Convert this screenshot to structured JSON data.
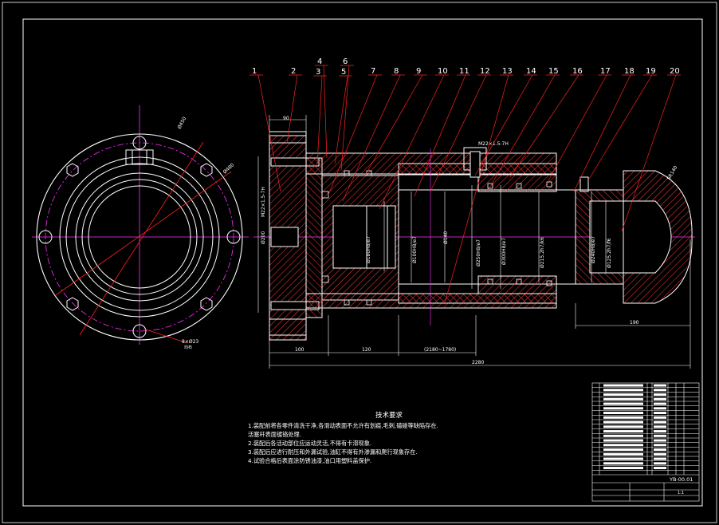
{
  "drawing": {
    "balloons": [
      "1",
      "2",
      "3",
      "4",
      "5",
      "6",
      "7",
      "8",
      "9",
      "10",
      "11",
      "12",
      "13",
      "14",
      "15",
      "16",
      "17",
      "18",
      "19",
      "20"
    ],
    "dims": {
      "bore_main": "Ø250H8/e7",
      "piston": "Ø180H8/e7",
      "rod": "Ø100H8/e7",
      "rod_b": "Ø140",
      "tube_ext": "Ø300H8/e7",
      "tube_ext2": "Ø325H8/e7",
      "gland": "Ø215.2h7/k6",
      "gland2": "Ø240H8/e7",
      "gland3": "Ø125.2h7/f6",
      "flange": "Ø200",
      "port": "M22×1.5-7H",
      "top_port": "M22×1.5-7H",
      "end_sph": "SR140",
      "len_100": "100",
      "len_120": "120",
      "len_stroke": "(2180~1780)",
      "len_total": "2280",
      "len_190": "190",
      "len_90": "90"
    },
    "flange_view": {
      "d1": "Ø450",
      "d2": "Ø480",
      "holes": "8×Ø23",
      "holes_note": "均布"
    }
  },
  "notes": {
    "title": "技术要求",
    "lines": [
      "1.装配前将各零件清洗干净,各滑动表面不允许有划痕,毛刺,磕碰等缺陷存在.",
      "  活塞杆表面镀铬处理.",
      "2.装配后各活动部位应运动灵活,不得有卡滞现象.",
      "3.装配后应进行耐压和外漏试验,油缸不得有外渗漏和爬行现象存在.",
      "4.试验合格后表面涂防锈油漆,油口用塑料盖保护."
    ]
  },
  "title_block": {
    "drawing_no": "YB-00.01",
    "sheet": "1:1",
    "rows": 20
  },
  "colors": {
    "line": "#ffffff",
    "hatch": "#ff3a3a",
    "center": "#ff30ff",
    "leader": "#ff2020",
    "dim": "#ffffff",
    "block": "#ffffff",
    "background": "#000000"
  }
}
